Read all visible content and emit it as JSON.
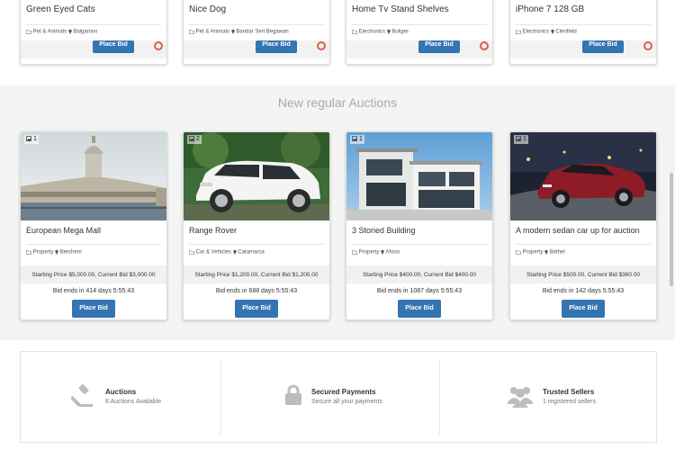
{
  "top_cards": [
    {
      "title": "Green Eyed Cats",
      "category": "Pet & Animals",
      "location": "Balgarovo",
      "bid_label": "Place Bid"
    },
    {
      "title": "Nice Dog",
      "category": "Pet & Animals",
      "location": "Bandar Seri Begawan",
      "bid_label": "Place Bid"
    },
    {
      "title": "Home Tv Stand Shelves",
      "category": "Electronics",
      "location": "Bukjae",
      "bid_label": "Place Bid"
    },
    {
      "title": "iPhone 7 128 GB",
      "category": "Electronics",
      "location": "Clenfield",
      "bid_label": "Place Bid"
    }
  ],
  "section_title": "New regular Auctions",
  "auctions": [
    {
      "photo_count": "1",
      "title": "European Mega Mall",
      "category": "Property",
      "location": "Berchem",
      "price": "Starting Price $5,000.00, Current Bid $3,000.00",
      "ends": "Bid ends in 414 days 5:55:43",
      "bid_label": "Place Bid"
    },
    {
      "photo_count": "2",
      "title": "Range Rover",
      "category": "Car & Vehicles",
      "location": "Catamarca",
      "price": "Starting Price $1,200.00, Current Bid $1,200.00",
      "ends": "Bid ends in 688 days 5:55:43",
      "bid_label": "Place Bid"
    },
    {
      "photo_count": "1",
      "title": "3 Storied Building",
      "category": "Property",
      "location": "Afono",
      "price": "Starting Price $400.00, Current Bid $400.00",
      "ends": "Bid ends in 1087 days 5:55:43",
      "bid_label": "Place Bid"
    },
    {
      "photo_count": "1",
      "title": "A modern sedan car up for auction",
      "category": "Property",
      "location": "Bethel",
      "price": "Starting Price $500.00, Current Bid $360.00",
      "ends": "Bid ends in 142 days 5:55:43",
      "bid_label": "Place Bid"
    }
  ],
  "features": [
    {
      "icon": "gavel-icon",
      "title": "Auctions",
      "subtitle": "8 Auctions Available"
    },
    {
      "icon": "lock-icon",
      "title": "Secured Payments",
      "subtitle": "Secure all your payments"
    },
    {
      "icon": "users-icon",
      "title": "Trusted Sellers",
      "subtitle": "1 registered sellers"
    }
  ],
  "colors": {
    "accent": "#3474b3",
    "section_bg": "#f4f4f4",
    "muted_title": "#aaaaaa",
    "gift": "#e25a4c"
  }
}
